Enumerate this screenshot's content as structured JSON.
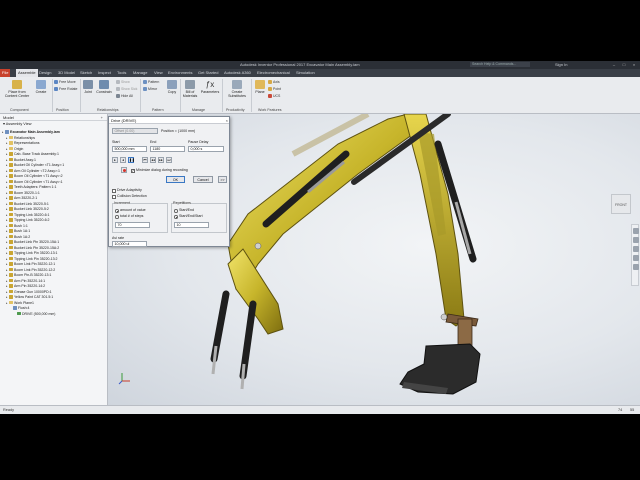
{
  "window": {
    "title": "Autodesk Inventor Professional 2017   Excavator Main Assembly.iam",
    "search_placeholder": "Search Help & Commands...",
    "sign_in": "Sign In"
  },
  "tabs": [
    "File",
    "Assemble",
    "Design",
    "3D Model",
    "Sketch",
    "Inspect",
    "Tools",
    "Manage",
    "View",
    "Environments",
    "Get Started",
    "Autodesk A360",
    "Electromechanical",
    "Simulation"
  ],
  "active_tab": "Assemble",
  "ribbon": {
    "place_label": "Place from Content Center",
    "create_label": "Create",
    "free_move": "Free Move",
    "free_rotate": "Free Rotate",
    "joint": "Joint",
    "constrain": "Constrain",
    "show": "Show",
    "show_sick": "Show Sick",
    "hide_all": "Hide All",
    "pattern": "Pattern",
    "mirror": "Mirror",
    "copy": "Copy",
    "bill_of_materials": "Bill of Materials",
    "parameters": "Parameters",
    "create_substitutes": "Create Substitutes",
    "plane": "Plane",
    "axis": "Axis",
    "point": "Point",
    "ucs": "UCS",
    "panels": [
      "Component",
      "Position",
      "Relationships",
      "Pattern",
      "Manage",
      "Productivity",
      "Work Features"
    ]
  },
  "browser": {
    "header": "Model",
    "view": "Assembly View",
    "nodes": [
      {
        "label": "Excavator Main Assembly.iam",
        "icon": "doc",
        "indent": 0,
        "bold": true
      },
      {
        "label": "Relationships",
        "icon": "fold",
        "indent": 1
      },
      {
        "label": "Representations",
        "icon": "fold",
        "indent": 1
      },
      {
        "label": "Origin",
        "icon": "fold",
        "indent": 1
      },
      {
        "label": "Cab- Base Track Assembly:1",
        "icon": "part",
        "indent": 1
      },
      {
        "label": "Bucket Assy:1",
        "icon": "part",
        "indent": 1
      },
      {
        "label": "Bucket Oil Cylinder <T1 Assy>:1",
        "icon": "part",
        "indent": 1
      },
      {
        "label": "Arm Oil Cylinder <T2 Assy>:1",
        "icon": "part",
        "indent": 1
      },
      {
        "label": "Boom Oil Cylinder <T1 Assy>:2",
        "icon": "part",
        "indent": 1
      },
      {
        "label": "Boom Oil Cylinder <T1 Assy>:1",
        "icon": "part",
        "indent": 1
      },
      {
        "label": "Teeth Adapters: Pattern 1:1",
        "icon": "part",
        "indent": 1
      },
      {
        "label": "Boom 35220-1:1",
        "icon": "part",
        "indent": 1
      },
      {
        "label": "Arm 35220-2:1",
        "icon": "part",
        "indent": 1
      },
      {
        "label": "Bucket Link 35220-5:1",
        "icon": "part",
        "indent": 1
      },
      {
        "label": "Bucket Link 35220-5:2",
        "icon": "part",
        "indent": 1
      },
      {
        "label": "Tipping Link 35220-6:1",
        "icon": "part",
        "indent": 1
      },
      {
        "label": "Tipping Link 35220-6:2",
        "icon": "part",
        "indent": 1
      },
      {
        "label": "Bush 1:1",
        "icon": "part",
        "indent": 1
      },
      {
        "label": "Bush 1A:1",
        "icon": "part",
        "indent": 1
      },
      {
        "label": "Bush 1A:2",
        "icon": "part",
        "indent": 1
      },
      {
        "label": "Bucket Link Pin 35220-15A:1",
        "icon": "part",
        "indent": 1
      },
      {
        "label": "Bucket Link Pin 35220-15A:2",
        "icon": "part",
        "indent": 1
      },
      {
        "label": "Tipping Link Pin 35220-13:1",
        "icon": "part",
        "indent": 1
      },
      {
        "label": "Tipping Link Pin 35220-13:2",
        "icon": "part",
        "indent": 1
      },
      {
        "label": "Boom Link Pin 35220-12:1",
        "icon": "part",
        "indent": 1
      },
      {
        "label": "Boom Link Pin 35220-12:2",
        "icon": "part",
        "indent": 1
      },
      {
        "label": "Boom Pin-B 35220-13:1",
        "icon": "part",
        "indent": 1
      },
      {
        "label": "Arm Pin 35220-14:1",
        "icon": "part",
        "indent": 1
      },
      {
        "label": "Arm Pin 35220-14:2",
        "icon": "part",
        "indent": 1
      },
      {
        "label": "Grease Gun 10000PD:1",
        "icon": "part",
        "indent": 1
      },
      {
        "label": "Yellow Paint CAT 301.5:1",
        "icon": "part",
        "indent": 1
      },
      {
        "label": "Work Plane1",
        "icon": "fold",
        "indent": 1
      },
      {
        "label": "Flush:4",
        "icon": "doc",
        "indent": 2
      },
      {
        "label": "DRIVE (500,000 mm)",
        "icon": "motion",
        "indent": 3
      }
    ]
  },
  "dialog": {
    "title": "Drive (DRIVE)",
    "offset_field": "Offset (0.00)",
    "position_readout": "Position = (1000 mm)",
    "start_label": "Start",
    "start_value": "500,000 mm",
    "end_label": "End",
    "end_value": "1180",
    "pause_label": "Pause Delay",
    "pause_value": "0,000 s",
    "minimize_label": "Minimize dialog during recording",
    "ok": "OK",
    "cancel": "Cancel",
    "more": ">>",
    "drive_adaptivity": "Drive Adaptivity",
    "collision_detection": "Collision Detection",
    "increment_label": "Increment",
    "amount_of_value": "amount of value",
    "total_steps": "total # of steps",
    "increment_value": "70",
    "repetitions_label": "Repetitions",
    "start_end": "Start/End",
    "start_end_start": "Start/End/Start",
    "repetitions_value": "10",
    "avi_rate_label": "Avi rate",
    "avi_rate_value": "10,000 ul"
  },
  "status": {
    "left": "Ready",
    "counts": [
      "74",
      "55"
    ]
  },
  "viewcube_label": "FRONT"
}
